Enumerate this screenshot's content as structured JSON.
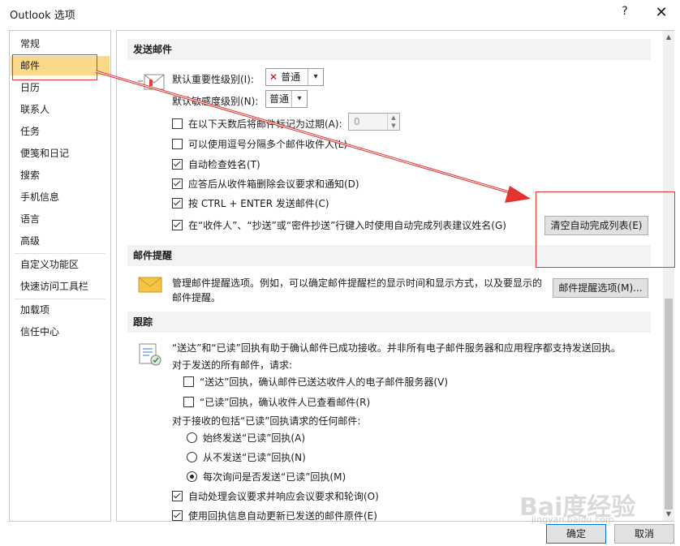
{
  "window": {
    "title": "Outlook 选项",
    "help_label": "?",
    "close_label": "✕"
  },
  "sidebar": {
    "items": [
      {
        "label": "常规"
      },
      {
        "label": "邮件"
      },
      {
        "label": "日历"
      },
      {
        "label": "联系人"
      },
      {
        "label": "任务"
      },
      {
        "label": "便笺和日记"
      },
      {
        "label": "搜索"
      },
      {
        "label": "手机信息"
      },
      {
        "label": "语言"
      },
      {
        "label": "高级"
      },
      {
        "label": "自定义功能区"
      },
      {
        "label": "快速访问工具栏"
      },
      {
        "label": "加载项"
      },
      {
        "label": "信任中心"
      }
    ],
    "selected": "邮件"
  },
  "send": {
    "header": "发送邮件",
    "importance_label": "默认重要性级别(I):",
    "importance_value": "普通",
    "sensitivity_label": "默认敏感度级别(N):",
    "sensitivity_value": "普通",
    "expire_label": "在以下天数后将邮件标记为过期(A):",
    "expire_value": "0",
    "comma_label": "可以使用逗号分隔多个邮件收件人(L)",
    "checknames_label": "自动检查姓名(T)",
    "delete_meeting_label": "应答后从收件箱删除会议要求和通知(D)",
    "ctrl_enter_label": "按 CTRL + ENTER 发送邮件(C)",
    "autocomplete_label": "在“收件人”、“抄送”或“密件抄送”行键入时使用自动完成列表建议姓名(G)",
    "clear_autocomplete_button": "清空自动完成列表(E)"
  },
  "reminders": {
    "header": "邮件提醒",
    "description_line1": "管理邮件提醒选项。例如，可以确定邮件提醒栏的显示时间和显示方式，以及要显示的",
    "description_line2": "邮件提醒。",
    "options_button": "邮件提醒选项(M)..."
  },
  "tracking": {
    "header": "跟踪",
    "description": "“送达”和“已读”回执有助于确认邮件已成功接收。并非所有电子邮件服务器和应用程序都支持发送回执。",
    "sent_label": "对于发送的所有邮件，请求:",
    "delivery_receipt_label": "“送达”回执，确认邮件已送达收件人的电子邮件服务器(V)",
    "read_receipt_label": "“已读”回执，确认收件人已查看邮件(R)",
    "incoming_label": "对于接收的包括“已读”回执请求的任何邮件:",
    "always_send_label": "始终发送“已读”回执(A)",
    "never_send_label": "从不发送“已读”回执(N)",
    "ask_label": "每次询问是否发送“已读”回执(M)",
    "auto_process_label": "自动处理会议要求并响应会议要求和轮询(O)",
    "update_original_label": "使用回执信息自动更新已发送的邮件原件(E)"
  },
  "footer": {
    "ok_button": "确定",
    "cancel_button": "取消"
  },
  "watermark": {
    "text": "Bai度经验",
    "sub": "jingyan.baidu.com"
  },
  "colors": {
    "selected_nav": "#fbd98a",
    "annotation_red": "#e33333"
  }
}
